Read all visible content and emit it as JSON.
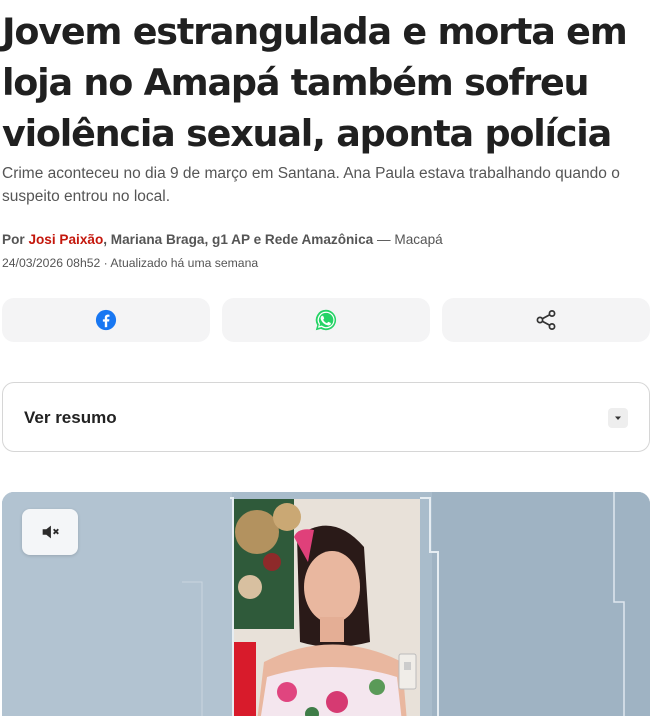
{
  "article": {
    "headline": "Jovem estrangulada e morta em loja no Amapá também sofreu violência sexual, aponta polícia",
    "subtitle": "Crime aconteceu no dia 9 de março em Santana. Ana Paula estava trabalhando quando o suspeito entrou no local.",
    "byline": {
      "prefix": "Por ",
      "author_link": "Josi Paixão",
      "other_authors": ", Mariana Braga, g1 AP e Rede Amazônica",
      "location": " — Macapá"
    },
    "dateline": "24/03/2026 08h52 · Atualizado há uma semana"
  },
  "share": {
    "facebook_icon": "facebook-icon",
    "whatsapp_icon": "whatsapp-icon",
    "share_icon": "share-icon",
    "colors": {
      "facebook": "#1877f2",
      "whatsapp": "#25d366",
      "share": "#333333"
    }
  },
  "summary": {
    "label": "Ver resumo",
    "toggle_icon": "caret-down-icon"
  },
  "video": {
    "mute_icon": "speaker-muted-icon"
  },
  "colors": {
    "accent_link": "#c4170c",
    "button_bg": "#f4f4f5"
  }
}
